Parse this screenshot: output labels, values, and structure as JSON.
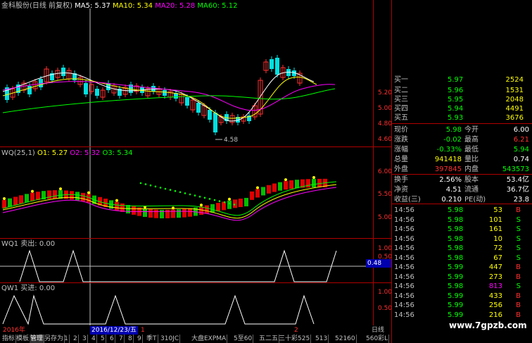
{
  "main_legend": {
    "name": "金科股份(日线 前复权)",
    "ma5": "MA5: 5.37",
    "ma10": "MA10: 5.34",
    "ma20": "MA20: 5.28",
    "ma60": "MA60: 5.12"
  },
  "price_axis": [
    "5.20",
    "5.00",
    "4.80",
    "4.60"
  ],
  "low_marker": "4.58",
  "wq_legend": {
    "name": "WQ(25,1)",
    "o1": "O1: 5.27",
    "o2": "O2: 5.32",
    "o3": "O3: 5.34"
  },
  "wq_axis": [
    "6.00",
    "5.50",
    "5.00"
  ],
  "wq1_legend": "WQ1 卖出: 0.00",
  "wq1_axis": [
    "1.00",
    "0.50"
  ],
  "wq1_current": "0.48",
  "qw1_legend": "QW1 买进: 0.00",
  "qw1_axis": [
    "1.00",
    "0.50"
  ],
  "time_axis": {
    "year": "2016年",
    "date": "2016/12/23/五",
    "m1": "1",
    "m2": "2",
    "period": "日线"
  },
  "tabs": [
    "指标",
    "模板",
    "管理",
    "另存为",
    "1",
    "2",
    "3",
    "4",
    "5",
    "6",
    "7",
    "8",
    "9",
    "季T",
    "310JC",
    "大盘EXPMA",
    "5至60",
    "五二五",
    "三十彩525",
    "513",
    "52160",
    "560彩L"
  ],
  "active_tab_index": 2,
  "order_book": [
    {
      "label": "买二",
      "price": "5.96",
      "vol": "1531"
    },
    {
      "label": "买三",
      "price": "5.95",
      "vol": "2048"
    },
    {
      "label": "买四",
      "price": "5.94",
      "vol": "4491"
    },
    {
      "label": "买五",
      "price": "5.93",
      "vol": "3676"
    }
  ],
  "order_book_partial": {
    "label": "买一",
    "price": "5.97",
    "vol": "2524"
  },
  "quote": [
    {
      "l1": "现价",
      "v1": "5.98",
      "l2": "今开",
      "v2": "6.00"
    },
    {
      "l1": "涨跌",
      "v1": "-0.02",
      "l2": "最高",
      "v2": "6.21"
    },
    {
      "l1": "涨幅",
      "v1": "-0.33%",
      "l2": "最低",
      "v2": "5.94"
    },
    {
      "l1": "总量",
      "v1": "941418",
      "l2": "量比",
      "v2": "0.74"
    },
    {
      "l1": "外盘",
      "v1": "397845",
      "l2": "内盘",
      "v2": "543573"
    }
  ],
  "stats": [
    {
      "l1": "换手",
      "v1": "2.56%",
      "l2": "股本",
      "v2": "53.4亿"
    },
    {
      "l1": "净资",
      "v1": "4.51",
      "l2": "流通",
      "v2": "36.7亿"
    },
    {
      "l1": "收益(三)",
      "v1": "0.210",
      "l2": "PE(动)",
      "v2": "23.8"
    }
  ],
  "ticks": [
    {
      "t": "14:56",
      "p": "5.98",
      "v": "53",
      "s": "B"
    },
    {
      "t": "14:56",
      "p": "5.98",
      "v": "101",
      "s": "S"
    },
    {
      "t": "14:56",
      "p": "5.98",
      "v": "161",
      "s": "S"
    },
    {
      "t": "14:56",
      "p": "5.98",
      "v": "10",
      "s": "S"
    },
    {
      "t": "14:56",
      "p": "5.98",
      "v": "72",
      "s": "S"
    },
    {
      "t": "14:56",
      "p": "5.98",
      "v": "67",
      "s": "S"
    },
    {
      "t": "14:56",
      "p": "5.99",
      "v": "447",
      "s": "B"
    },
    {
      "t": "14:56",
      "p": "5.99",
      "v": "273",
      "s": "B"
    },
    {
      "t": "14:56",
      "p": "5.98",
      "v": "813",
      "s": "S"
    },
    {
      "t": "14:56",
      "p": "5.99",
      "v": "433",
      "s": "B"
    },
    {
      "t": "14:56",
      "p": "5.99",
      "v": "256",
      "s": "B"
    },
    {
      "t": "14:56",
      "p": "5.99",
      "v": "216",
      "s": "B"
    }
  ],
  "watermark": "www.7gpzb.com",
  "colors": {
    "up": "#ff3030",
    "down": "#00e0e0",
    "ma5": "#ffffff",
    "ma10": "#ffff00",
    "ma20": "#ff00ff",
    "ma60": "#00ff00",
    "grid": "#b00000",
    "yellow": "#ffff00",
    "green": "#00ff00"
  }
}
